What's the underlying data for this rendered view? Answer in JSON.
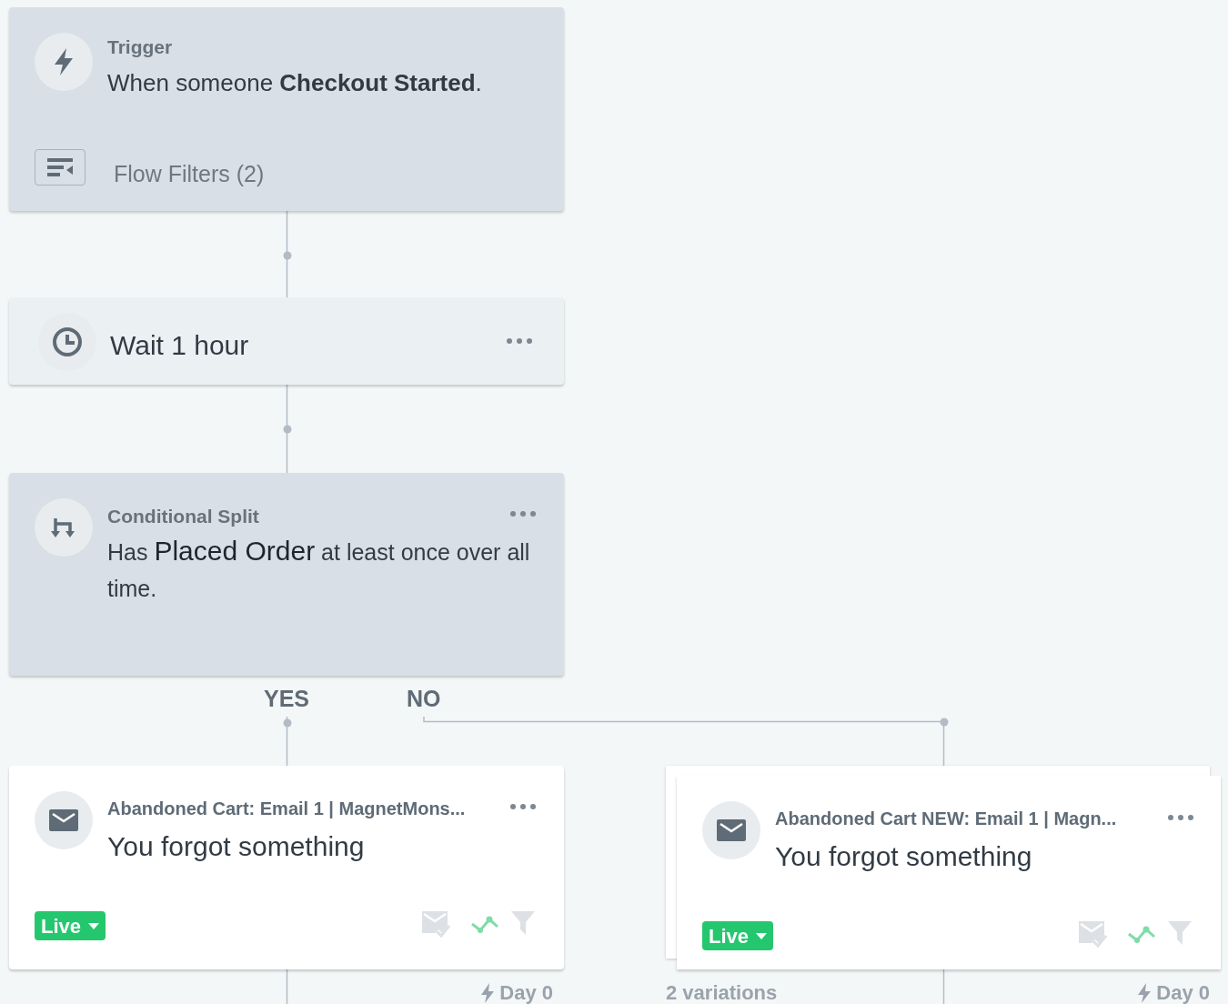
{
  "trigger": {
    "label": "Trigger",
    "description": "When someone **Checkout Started**.",
    "filters": "Flow Filters (2)"
  },
  "wait": {
    "label": "Wait 1 hour"
  },
  "split": {
    "label": "Conditional Split",
    "description": "Has **Placed Order** at least once over all time.",
    "branches": [
      "YES",
      "NO"
    ]
  },
  "emails": [
    {
      "title": "Abandoned Cart: Email 1 | MagnetMons...",
      "subject": "You forgot something",
      "status": "Live",
      "stacked": false,
      "delay": "Day 0"
    },
    {
      "title": "Abandoned Cart NEW: Email 1 | Magn...",
      "subject": "You forgot something",
      "status": "Live",
      "stacked": true,
      "variations": "2 variations",
      "delay": "Day 0"
    }
  ]
}
